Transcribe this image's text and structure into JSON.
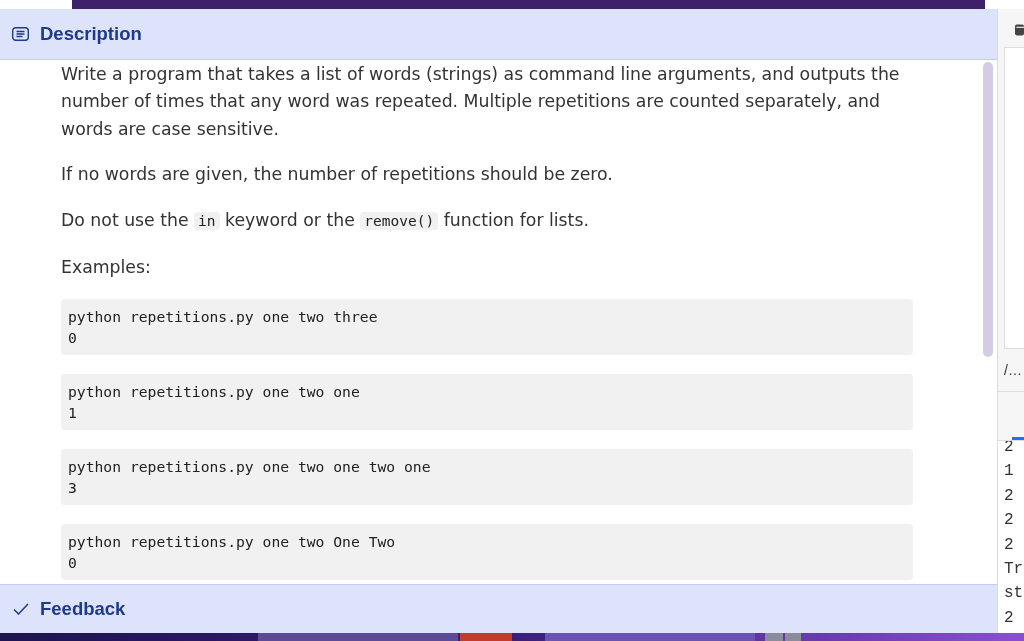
{
  "description": {
    "title": "Description",
    "paragraphs": [
      [
        {
          "kind": "text",
          "text": "Write a program that takes a list of words (strings) as command line arguments, and outputs the number of times that any word was repeated. Multiple repetitions are counted separately, and words are case sensitive."
        }
      ],
      [
        {
          "kind": "text",
          "text": "If no words are given, the number of repetitions should be zero."
        }
      ],
      [
        {
          "kind": "text",
          "text": "Do not use the "
        },
        {
          "kind": "code",
          "text": "in"
        },
        {
          "kind": "text",
          "text": " keyword or the "
        },
        {
          "kind": "code",
          "text": "remove()"
        },
        {
          "kind": "text",
          "text": " function for lists."
        }
      ],
      [
        {
          "kind": "text",
          "text": "Examples:"
        }
      ]
    ],
    "examples": [
      {
        "command": "python repetitions.py one two three",
        "output": "0"
      },
      {
        "command": "python repetitions.py one two one",
        "output": "1"
      },
      {
        "command": "python repetitions.py one two one two one",
        "output": "3"
      },
      {
        "command": "python repetitions.py one two One Two",
        "output": "0"
      }
    ]
  },
  "feedback": {
    "title": "Feedback"
  },
  "side_panel": {
    "path": "/…",
    "output_lines": [
      "2",
      "1",
      "2",
      "2",
      "2",
      "Tr",
      "st",
      "2"
    ]
  }
}
